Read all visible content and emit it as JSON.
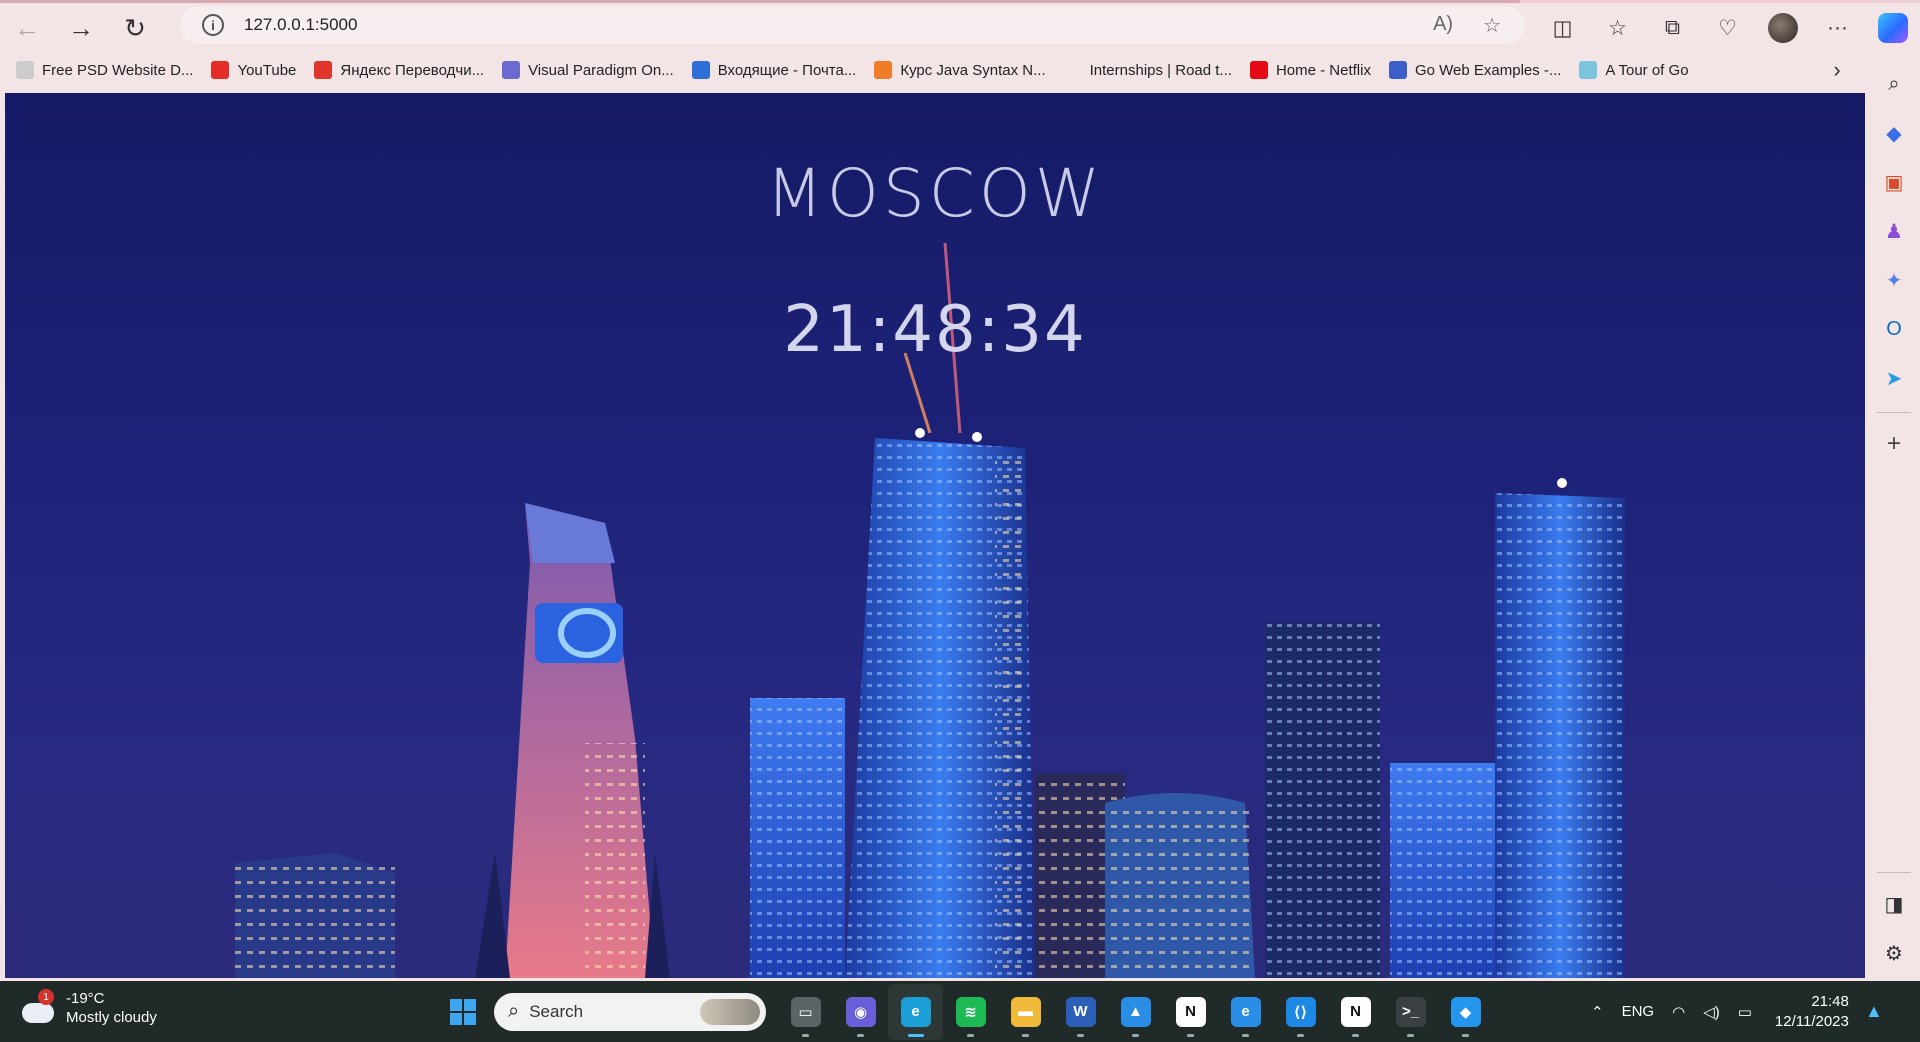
{
  "browser": {
    "url": "127.0.0.1:5000",
    "bookmarks": [
      {
        "label": "Free PSD Website D...",
        "icon": "psd-favicon",
        "color": "#cccccc"
      },
      {
        "label": "YouTube",
        "icon": "youtube-favicon",
        "color": "#e52d27"
      },
      {
        "label": "Яндекс Переводчи...",
        "icon": "yandex-translate-favicon",
        "color": "#e0352b"
      },
      {
        "label": "Visual Paradigm On...",
        "icon": "visual-paradigm-favicon",
        "color": "#6a6ad0"
      },
      {
        "label": "Входящие - Почта...",
        "icon": "mail-favicon",
        "color": "#2d6fd6"
      },
      {
        "label": "Курс Java Syntax N...",
        "icon": "javarush-favicon",
        "color": "#f07c2a"
      },
      {
        "label": "Internships | Road t...",
        "icon": "internships-favicon",
        "color": "#f3e4e6"
      },
      {
        "label": "Home - Netflix",
        "icon": "netflix-favicon",
        "color": "#e50914"
      },
      {
        "label": "Go Web Examples -...",
        "icon": "go-favicon",
        "color": "#3b5ec9"
      },
      {
        "label": "A Tour of Go",
        "icon": "gopher-favicon",
        "color": "#7cc3dd"
      }
    ]
  },
  "page": {
    "city": "MOSCOW",
    "time": "21:48:34"
  },
  "taskbar": {
    "weather": {
      "temp": "-19°C",
      "condition": "Mostly cloudy",
      "badge": "1"
    },
    "search_label": "Search",
    "apps": [
      {
        "name": "task-view",
        "glyph": "▭",
        "color": "#5a6466"
      },
      {
        "name": "chat",
        "glyph": "◉",
        "color": "#6b5fd9"
      },
      {
        "name": "edge",
        "glyph": "e",
        "color": "#1c9ed6"
      },
      {
        "name": "spotify",
        "glyph": "≋",
        "color": "#1db954"
      },
      {
        "name": "file-explorer",
        "glyph": "▬",
        "color": "#f1b93a"
      },
      {
        "name": "word",
        "glyph": "W",
        "color": "#2b5fb8"
      },
      {
        "name": "photos",
        "glyph": "▲",
        "color": "#2b8ee6"
      },
      {
        "name": "notion",
        "glyph": "N",
        "color": "#ffffff"
      },
      {
        "name": "edge-dev",
        "glyph": "e",
        "color": "#2b8ee6"
      },
      {
        "name": "vscode",
        "glyph": "⟨⟩",
        "color": "#1e88e5"
      },
      {
        "name": "notion-2",
        "glyph": "N",
        "color": "#ffffff"
      },
      {
        "name": "terminal",
        "glyph": ">_",
        "color": "#3a3f44"
      },
      {
        "name": "docker",
        "glyph": "◆",
        "color": "#2496ed"
      }
    ],
    "lang": "ENG",
    "time": "21:48",
    "date": "12/11/2023"
  }
}
